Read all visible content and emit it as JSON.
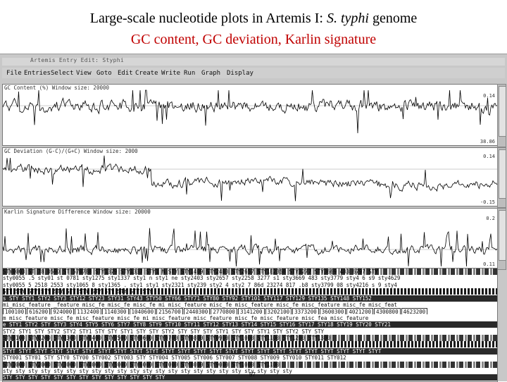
{
  "slide": {
    "title_prefix": "Large-scale nucleotide plots in Artemis I: ",
    "title_italic": "S. typhi",
    "title_suffix": " genome",
    "subtitle": "GC content, GC deviation, Karlin signature",
    "page_number": "57"
  },
  "window": {
    "title": "Artemis Entry Edit: Styphi",
    "menu": [
      "File",
      "Entries",
      "Select",
      "View",
      "Goto",
      "Edit",
      "Create",
      "Write",
      "Run",
      "Graph",
      "Display"
    ]
  },
  "panels": [
    {
      "label": "GC Content (%)  Window size: 20000",
      "max": "0.14",
      "min": "38.86"
    },
    {
      "label": "GC Deviation (G-C)/(G+C)  Window size: 2000",
      "max": "0.14",
      "min": "-0.15"
    },
    {
      "label": "Karlin Signature Difference  Window size: 20000",
      "max": "0.2",
      "min": "0.11"
    }
  ],
  "feature_rows": [
    {
      "style": "mixed",
      "text": "STY0003  ST 78  0590  ST  570788 STY1379 STY1337  STY1 N  STY  STY1409  STY2403 STY2657  STY1E2358 STY3277  STY3669 483    6797  STY"
    },
    {
      "style": "plain",
      "text": "sty0055 .5 sty01  st 0781 sty1275  sty1337  sty1 n  sty1 ne sty2403 sty2657 sty2258 3277 s1  sty3669 483    sty3779  sty4 6  s9 sty4629"
    },
    {
      "style": "plain",
      "text": "sty0055 5 2518 2553  sty1065 8 sty1365 .  sty1 sty1 sty2321  sty239 sty2 4  sty2 7  86d 23274 817  .b8 sty3799 08 sty4216  s 9 sty4"
    },
    {
      "style": "striped",
      "text": "            STY     STY     STY     STY     STY     STY     STY     STY     STY     STY     STY     STY"
    },
    {
      "style": "dark",
      "text": " s STY  STY1  STY2  STY3 STY12 STY23 STY31 STY43 STY50 STY66 STY71 STY80 STY92 STY101 STY117 STY129 STY135 STY148 STY152"
    },
    {
      "style": "plain",
      "text": "mi_misc_feature  _feature misc_fe misc_fe  misc_fe  mi misc_feature  misc_fe misc_feature  misc_fe  misc_feature  misc_fe  misc_feat"
    },
    {
      "style": "boxed",
      "cells": [
        "100100",
        "616200",
        "924000",
        "1132400",
        "1140300",
        "1040600",
        "2156700",
        "2440300",
        "2770800",
        "3141200",
        "3202100",
        "3373200",
        "3600300",
        "4021200",
        "4300800",
        "4623200"
      ]
    },
    {
      "style": "plain",
      "text": "m misc_feature   misc_fe misc_feature   misc_fe   mi misc_feature   misc_feature   misc_fe   misc_feature   misc_fea   misc_feature"
    },
    {
      "style": "dark",
      "text": " e STY1  STY2 STY STY3  STY4 STY5 STY6 STY7 STY8 STY9 STY10 STY11 STY12 STY13 STY14 STY15 STY16 STY17 STY18 STY19 STY20 STY21"
    },
    {
      "style": "plain",
      "text": "STY2 STY1  STY  STY2  STY2  STY1 STY STY  STY1  STY  STY  STY2 STY  STY  STY  STY1 STY  STY  STY1  STY  STY2 STY  STY"
    },
    {
      "style": "mixed",
      "text": "STY0100  STY0200  STY0300  STY0400  STY0500  STY0600  STY0700  STY0800  STY0900  STY1000  STY1100  STY1200  STY1300"
    },
    {
      "style": "striped",
      "text": "                                                                                                               "
    },
    {
      "style": "dark",
      "text": " STYT STYT STYT STYT STYT STYT STYT STYT STYT STYT STYT STYT STYT STYT STYT STYT STYT STYT STYT STYT STYT STYT STYT STYT"
    },
    {
      "style": "plain",
      "text": "STY001 STY01  STY  STY0 STY00 STY002 STY003 STY STY004 STY005  STY006  STY007  STY008 STY009 STY010  STY011 STY012"
    },
    {
      "style": "mixed",
      "text": "STY1000 STY2000  STY3000  STY4000  STY5000 STY6000  STY7000  STY8000  STY9000  STY1000 STY1100"
    },
    {
      "style": "plain",
      "text": "sty sty  sty sty  sty sty sty  sty  sty  sty  sty sty  sty  sty  sty  sty sty  sty sty  sty  sty  sty  sty"
    },
    {
      "style": "dark",
      "text": "  STY     STY     STY     STY     STY     STY     STY     STY     STY     STY     STY     STY     STY"
    }
  ]
}
